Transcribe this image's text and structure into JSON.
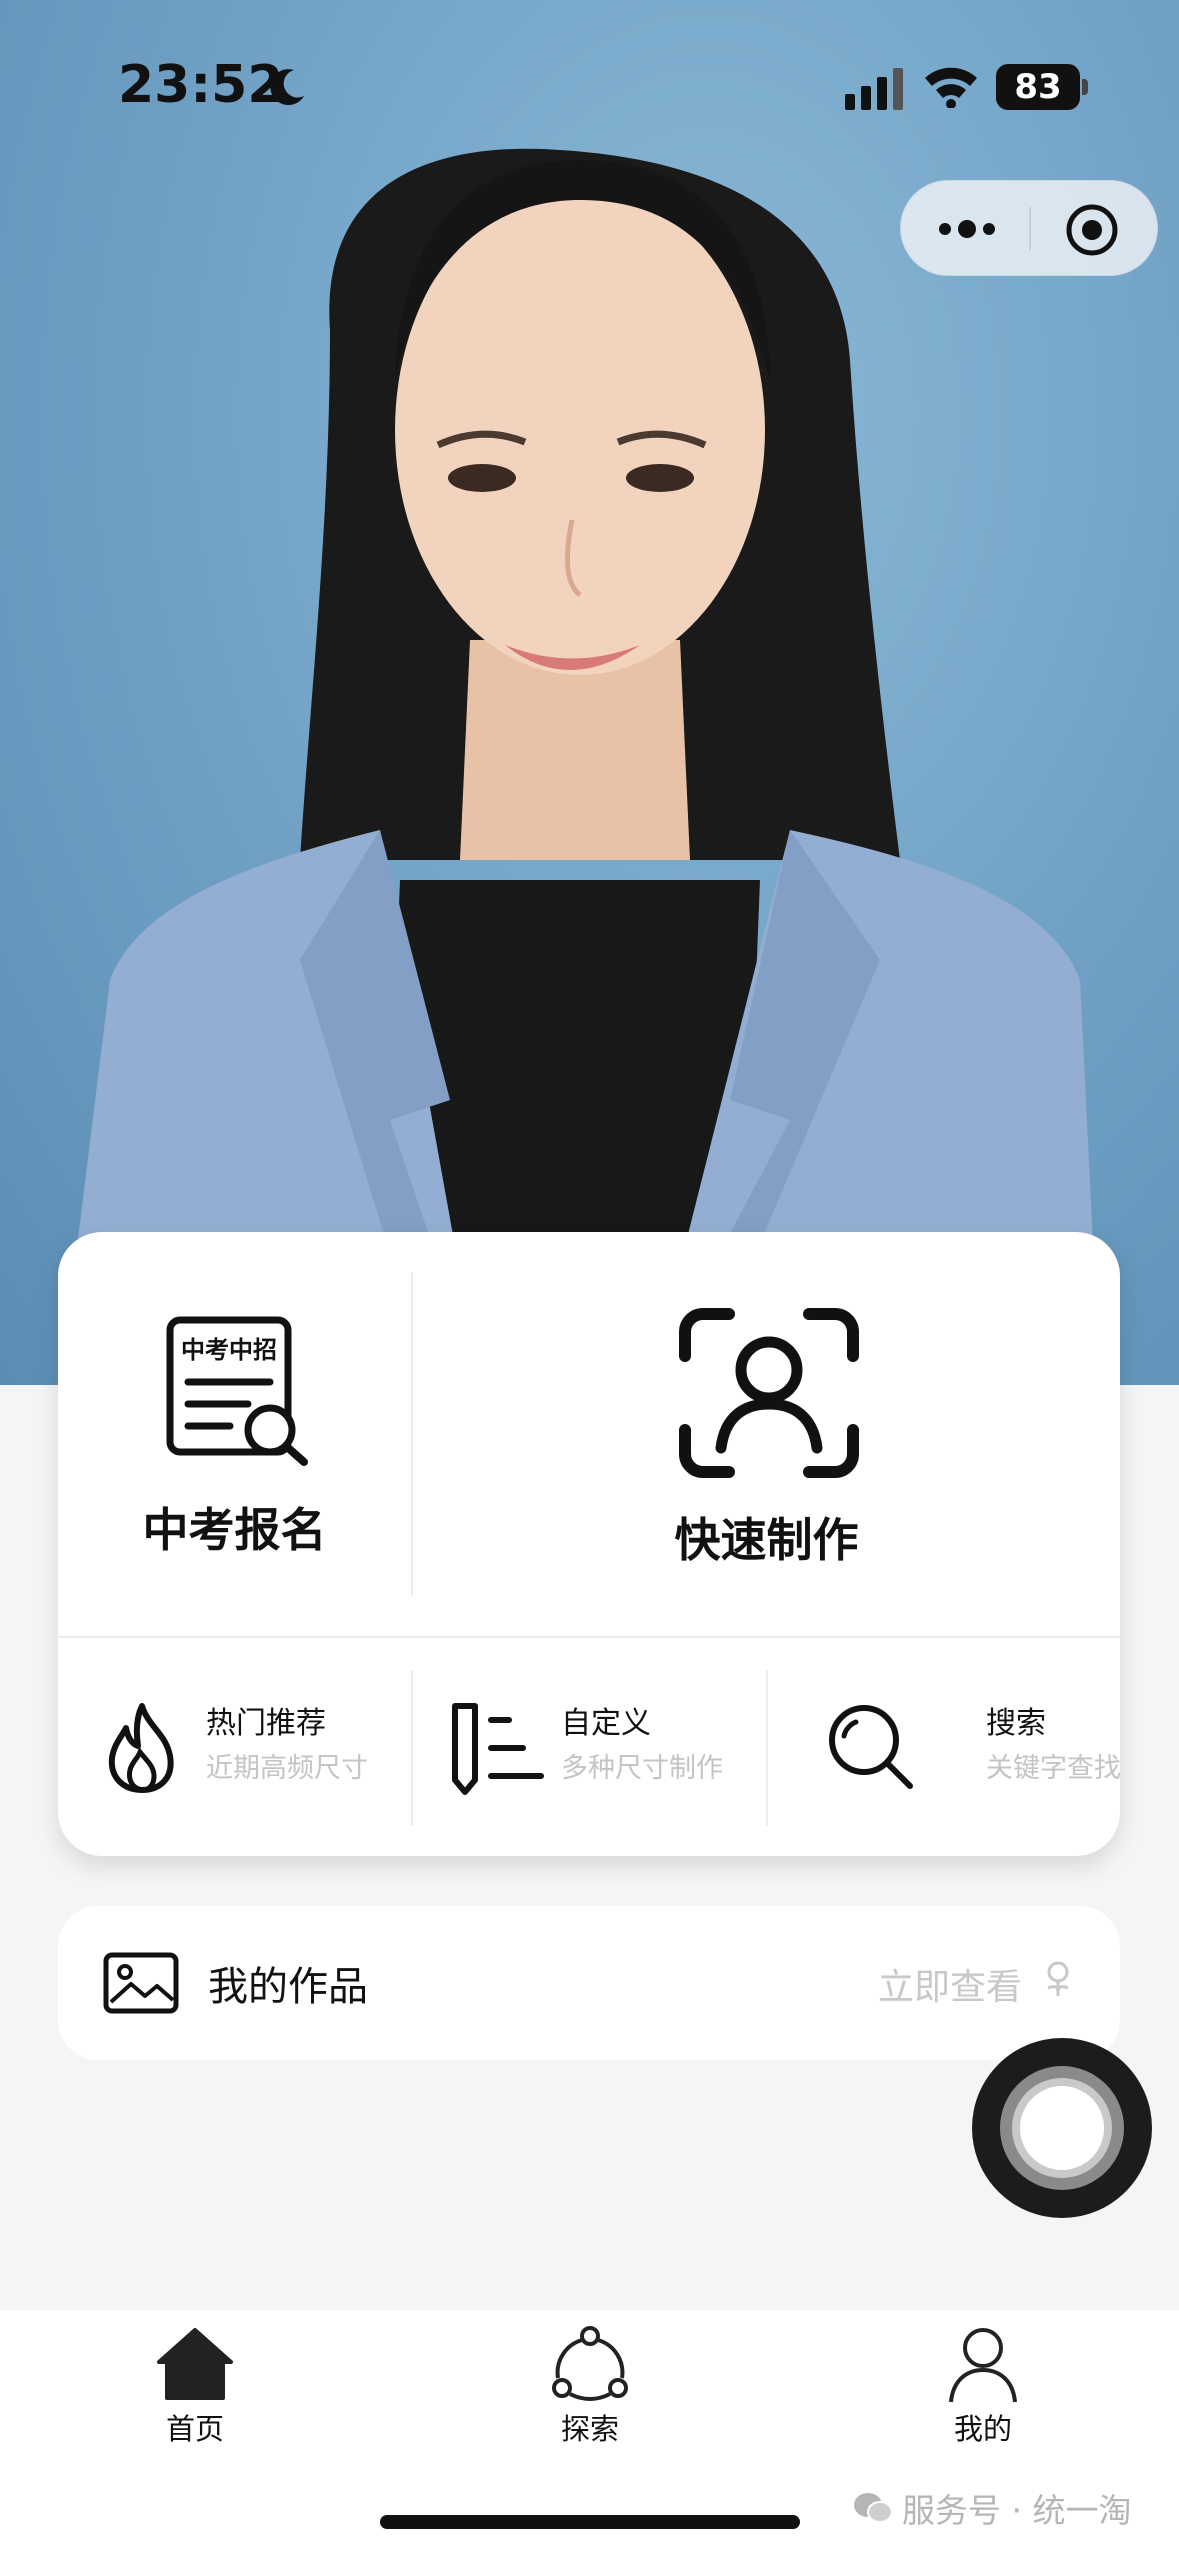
{
  "status_bar": {
    "time": "23:52",
    "battery": "83"
  },
  "hero": {
    "background_color": "#6fa0c4"
  },
  "main_card": {
    "register": {
      "icon_text": "中考中招",
      "label": "中考报名"
    },
    "quick_make": {
      "label": "快速制作"
    },
    "features": [
      {
        "title": "热门推荐",
        "subtitle": "近期高频尺寸",
        "icon": "flame-icon"
      },
      {
        "title": "自定义",
        "subtitle": "多种尺寸制作",
        "icon": "pencil-list-icon"
      },
      {
        "title": "搜索",
        "subtitle": "关键字查找",
        "icon": "search-icon"
      }
    ]
  },
  "my_works": {
    "label": "我的作品",
    "action": "立即查看"
  },
  "tabs": [
    {
      "label": "首页",
      "icon": "home-icon",
      "active": true
    },
    {
      "label": "探索",
      "icon": "explore-icon",
      "active": false
    },
    {
      "label": "我的",
      "icon": "user-icon",
      "active": false
    }
  ],
  "watermark": "服务号 · 统一淘"
}
